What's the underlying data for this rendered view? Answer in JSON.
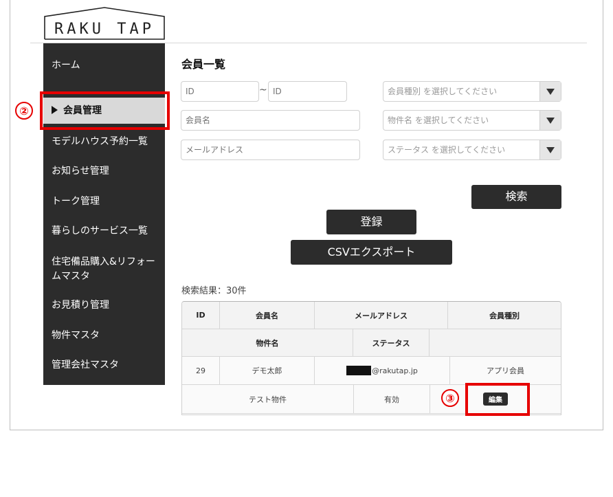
{
  "header": {
    "logo_text": "RAKU TAP"
  },
  "sidebar": {
    "items": [
      {
        "label": "ホーム"
      },
      {
        "label": "会員管理"
      },
      {
        "label": "モデルハウス予約一覧"
      },
      {
        "label": "お知らせ管理"
      },
      {
        "label": "トーク管理"
      },
      {
        "label": "暮らしのサービス一覧"
      },
      {
        "label": "住宅備品購入&リフォームマスタ"
      },
      {
        "label": "お見積り管理"
      },
      {
        "label": "物件マスタ"
      },
      {
        "label": "管理会社マスタ"
      }
    ]
  },
  "annotations": {
    "step2": "②",
    "step3": "③"
  },
  "main": {
    "title": "会員一覧",
    "filters": {
      "id_from_placeholder": "ID",
      "range_sep": "~",
      "id_to_placeholder": "ID",
      "member_name_placeholder": "会員名",
      "email_placeholder": "メールアドレス",
      "member_type_select": "会員種別 を選択してください",
      "property_select": "物件名 を選択してください",
      "status_select": "ステータス を選択してください"
    },
    "buttons": {
      "search": "検索",
      "register": "登録",
      "csv_export": "CSVエクスポート"
    },
    "results_count": "検索結果：30件",
    "table": {
      "headers_row1": [
        "ID",
        "会員名",
        "メールアドレス",
        "会員種別"
      ],
      "headers_row2": [
        "物件名",
        "ステータス",
        ""
      ],
      "row1": {
        "id": "29",
        "name": "デモ太郎",
        "email_suffix": "@rakutap.jp",
        "member_type": "アプリ会員",
        "property": "テスト物件",
        "status": "有効",
        "action": "編集"
      }
    }
  },
  "colors": {
    "sidebar_bg": "#2c2c2c",
    "annotation_red": "#e60000",
    "button_bg": "#2c2c2c"
  }
}
